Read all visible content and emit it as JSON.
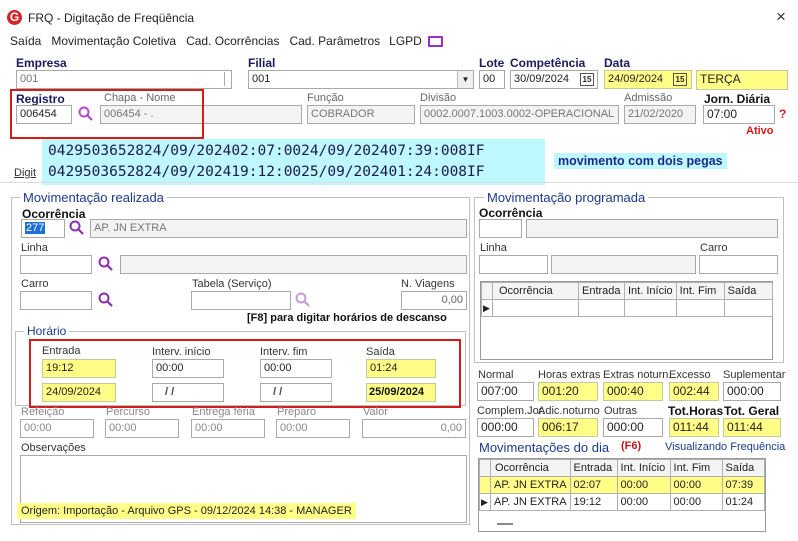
{
  "window": {
    "title": "FRQ - Digitação de Freqüência",
    "close": "×"
  },
  "menu": {
    "items": [
      "Saída",
      "Movimentação Coletiva",
      "Cad. Ocorrências",
      "Cad. Parâmetros",
      "LGPD"
    ]
  },
  "header": {
    "empresa_label": "Empresa",
    "empresa_value": "001",
    "filial_label": "Filial",
    "filial_value": "001",
    "lote_label": "Lote",
    "lote_value": "00",
    "competencia_label": "Competência",
    "competencia_value": "30/09/2024",
    "data_label": "Data",
    "data_value": "24/09/2024",
    "weekday": "TERÇA",
    "registro_label": "Registro",
    "registro_value": "006454",
    "chapa_label": "Chapa  -  Nome",
    "chapa_value": "006454 - .",
    "funcao_label": "Função",
    "funcao_value": "COBRADOR",
    "divisao_label": "Divisão",
    "divisao_value": "0002.0007.1003.0002-OPERACIONAL",
    "admissao_label": "Admissão",
    "admissao_value": "21/02/2020",
    "jornada_label": "Jorn. Diária",
    "jornada_value": "07:00",
    "help": "?",
    "status": "Ativo"
  },
  "gps_lines": [
    "0429503652824/09/202402:07:0024/09/202407:39:008IF",
    "0429503652824/09/202419:12:0025/09/202401:24:008IF"
  ],
  "annotation": "movimento com dois pegas",
  "tab_fragment": "Digit",
  "realizada": {
    "title": "Movimentação realizada",
    "ocorrencia_label": "Ocorrência",
    "ocorrencia_code": "277",
    "ocorrencia_desc": "AP. JN EXTRA",
    "linha_label": "Linha",
    "carro_label": "Carro",
    "tabela_label": "Tabela (Serviço)",
    "viagens_label": "N. Viagens",
    "viagens_value": "0,00",
    "f8_hint": "[F8] para digitar horários de descanso",
    "horario_title": "Horário",
    "entrada_label": "Entrada",
    "entrada_time": "19:12",
    "entrada_date": "24/09/2024",
    "interv_inicio_label": "Interv. início",
    "interv_inicio_time": "00:00",
    "interv_inicio_date": "/ /",
    "interv_fim_label": "Interv. fim",
    "interv_fim_time": "00:00",
    "interv_fim_date": "/ /",
    "saida_label": "Saída",
    "saida_time": "01:24",
    "saida_date": "25/09/2024",
    "refeicao_label": "Refeição",
    "refeicao_value": "00:00",
    "percurso_label": "Percurso",
    "percurso_value": "00:00",
    "entrega_label": "Entrega féria",
    "entrega_value": "00:00",
    "preparo_label": "Preparo",
    "preparo_value": "00:00",
    "valor_label": "Valor",
    "valor_value": "0,00",
    "obs_label": "Observações",
    "origem": "Origem: Importação - Arquivo GPS - 09/12/2024 14:38 - MANAGER"
  },
  "programada": {
    "title": "Movimentação programada",
    "ocorrencia_label": "Ocorrência",
    "linha_label": "Linha",
    "carro_label": "Carro",
    "columns": [
      "Ocorrência",
      "Entrada",
      "Int. Início",
      "Int. Fim",
      "Saída"
    ]
  },
  "totais": {
    "normal_label": "Normal",
    "normal_value": "007:00",
    "extras_label": "Horas extras",
    "extras_value": "001:20",
    "extras_noturn_label": "Extras noturn.",
    "extras_noturn_value": "000:40",
    "excesso_label": "Excesso",
    "excesso_value": "002:44",
    "suplementar_label": "Suplementar",
    "suplementar_value": "000:00",
    "complem_label": "Complem.Jor.",
    "complem_value": "000:00",
    "adic_label": "Adic.noturno",
    "adic_value": "006:17",
    "outras_label": "Outras",
    "outras_value": "000:00",
    "tot_horas_label": "Tot.Horas",
    "tot_horas_value": "011:44",
    "tot_geral_label": "Tot. Geral",
    "tot_geral_value": "011:44"
  },
  "dia": {
    "title": "Movimentações do dia",
    "f6": "(F6)",
    "link": "Visualizando Frequência",
    "columns": [
      "Ocorrência",
      "Entrada",
      "Int. Início",
      "Int. Fim",
      "Saída"
    ],
    "rows": [
      {
        "ocorrencia": "AP. JN EXTRA",
        "entrada": "02:07",
        "int_inicio": "00:00",
        "int_fim": "00:00",
        "saida": "07:39"
      },
      {
        "ocorrencia": "AP. JN EXTRA",
        "entrada": "19:12",
        "int_inicio": "00:00",
        "int_fim": "00:00",
        "saida": "01:24"
      }
    ]
  },
  "colors": {
    "accent": "#1a3a8a",
    "highlight": "#ffff88",
    "red": "#d41c1c",
    "gps_bg": "#bff7ff",
    "brand": "#d0262a"
  }
}
